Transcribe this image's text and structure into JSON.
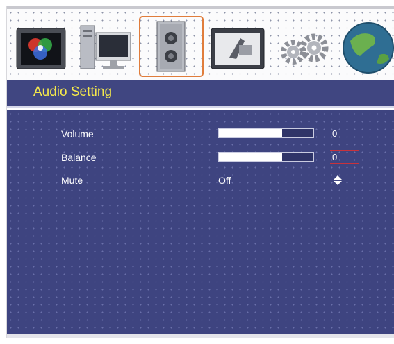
{
  "menu": {
    "tabs": [
      {
        "name": "picture",
        "icon": "color-monitor-icon",
        "selected": false
      },
      {
        "name": "source",
        "icon": "computer-icon",
        "selected": false
      },
      {
        "name": "audio",
        "icon": "speaker-icon",
        "selected": true
      },
      {
        "name": "image-adjust",
        "icon": "screen-icon",
        "selected": false
      },
      {
        "name": "setup",
        "icon": "gears-icon",
        "selected": false
      },
      {
        "name": "language",
        "icon": "globe-icon",
        "selected": false
      }
    ]
  },
  "page": {
    "title": "Audio Setting"
  },
  "settings": {
    "volume": {
      "label": "Volume",
      "value": "0",
      "level": 0.67
    },
    "balance": {
      "label": "Balance",
      "value": "0",
      "level": 0.67
    },
    "mute": {
      "label": "Mute",
      "value": "Off"
    }
  },
  "colors": {
    "panel": "#3e4480",
    "title_bar": "#404681",
    "title_text": "#f4e84b",
    "selected_tab_border": "#e07d3c",
    "focus_box": "#c8323c"
  }
}
